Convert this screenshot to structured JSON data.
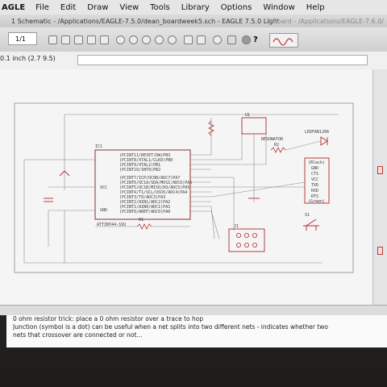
{
  "menubar": {
    "app_name": "AGLE",
    "items": [
      "File",
      "Edit",
      "Draw",
      "View",
      "Tools",
      "Library",
      "Options",
      "Window",
      "Help"
    ]
  },
  "titlebar": {
    "title": "1 Schematic - /Applications/EAGLE-7.5.0/dean_boardweek5.sch - EAGLE 7.5.0 Light",
    "secondary": "2 Board - /Applications/EAGLE-7.6.0/"
  },
  "toolbar": {
    "sheet_value": "1/1",
    "help_icon": "?"
  },
  "coordinates": {
    "readout": "0.1 inch (2.7 9.5)"
  },
  "schematic": {
    "ic1_name": "IC1",
    "ic1_value": "ATTINY44-SSU",
    "ic1_pins": [
      "(PCINT11/RESET/DW)PB3",
      "(PCINT8/XTAL1/CLKO)PB0",
      "(PCINT9/XTAL2)PB1",
      "(PCINT10/INT0)PB2",
      "(PCINT7/ICP/OC0B/ADC7)PA7",
      "(PCINT6/OC1A/SDA/MOSI/ADC6)PA6",
      "(PCINT5/OC1B/MISO/DO/ADC5)PA5",
      "(PCINT4/T1/SCL/USCK/ADC4)PA4",
      "(PCINT3/T0/ADC3)PA3",
      "(PCINT2/AIN1/ADC2)PA2",
      "(PCINT1/AIN0/ADC1)PA1",
      "(PCINT0/AREF/ADC0)PA0"
    ],
    "vcc_label": "VCC",
    "gnd_label": "GND",
    "u1_name": "U1",
    "resonator_label": "RESONATOR",
    "led_label": "LEDFAB1206",
    "r_label": "R2",
    "r1_label": "R1",
    "ftdi_header": "(Black)",
    "ftdi_pins": [
      "GND",
      "CTS",
      "VCC",
      "TXD",
      "RXD",
      "RTS"
    ],
    "ftdi_footer": "(Green)",
    "switch_label": "S1",
    "isp_label": "J1"
  },
  "notes": {
    "line1": "0 ohm resistor trick: place a 0 ohm resistor over a trace to hop",
    "line2": "Junction (symbol is a dot) can be useful when a net splits into two different nets - indicates whether two",
    "line3": "nets that crossover are connected or not..."
  }
}
